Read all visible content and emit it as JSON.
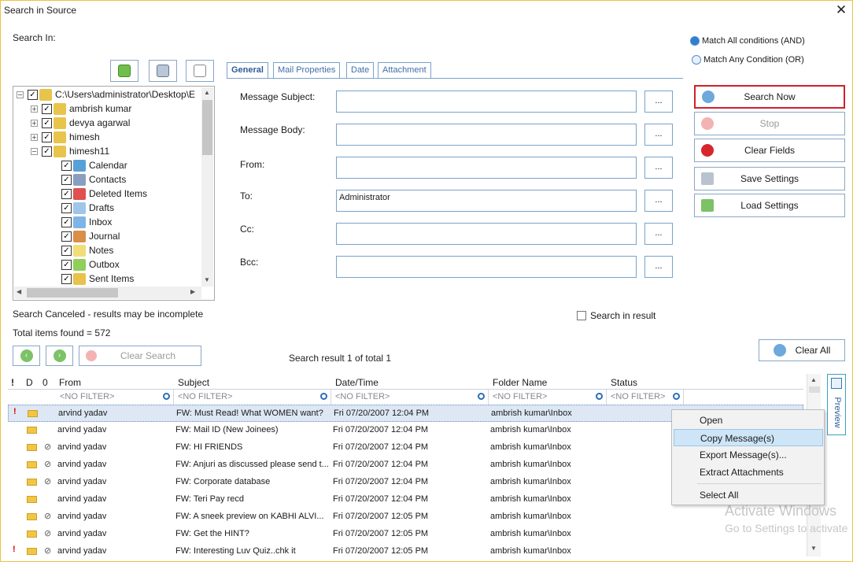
{
  "window": {
    "title": "Search in Source",
    "close": "✕"
  },
  "search_in_label": "Search In:",
  "tree": {
    "root": "C:\\Users\\administrator\\Desktop\\E",
    "items": [
      "ambrish kumar",
      "devya agarwal",
      "himesh",
      "himesh11"
    ],
    "folders": [
      "Calendar",
      "Contacts",
      "Deleted Items",
      "Drafts",
      "Inbox",
      "Journal",
      "Notes",
      "Outbox",
      "Sent Items"
    ]
  },
  "tabs": [
    "General",
    "Mail Properties",
    "Date",
    "Attachment"
  ],
  "fields": {
    "labels": [
      "Message Subject:",
      "Message Body:",
      "From:",
      "To:",
      "Cc:",
      "Bcc:"
    ],
    "to_value": "Administrator",
    "browse": "..."
  },
  "match": {
    "all": "Match All conditions (AND)",
    "any": "Match Any Condition (OR)"
  },
  "buttons": {
    "search_now": "Search Now",
    "stop": "Stop",
    "clear_fields": "Clear Fields",
    "save_settings": "Save Settings",
    "load_settings": "Load Settings",
    "clear_search": "Clear Search",
    "clear_all": "Clear All"
  },
  "status": {
    "canceled": "Search Canceled - results may be incomplete",
    "total": "Total items found = 572",
    "search_in_result": "Search in result",
    "result_info": "Search result 1 of total 1"
  },
  "grid": {
    "icon_headers": [
      "!",
      "D",
      "0"
    ],
    "columns": [
      "From",
      "Subject",
      "Date/Time",
      "Folder Name",
      "Status"
    ],
    "filter": "<NO FILTER>",
    "rows": [
      {
        "from": "arvind yadav",
        "subject": "FW: Must Read! What WOMEN want?",
        "date": "Fri 07/20/2007 12:04 PM",
        "folder": "ambrish kumar\\Inbox",
        "imp": true,
        "att": false
      },
      {
        "from": "arvind yadav",
        "subject": "FW: Mail ID (New Joinees)",
        "date": "Fri 07/20/2007 12:04 PM",
        "folder": "ambrish kumar\\Inbox",
        "imp": false,
        "att": false
      },
      {
        "from": "arvind yadav",
        "subject": "FW: HI FRIENDS",
        "date": "Fri 07/20/2007 12:04 PM",
        "folder": "ambrish kumar\\Inbox",
        "imp": false,
        "att": true
      },
      {
        "from": "arvind yadav",
        "subject": "FW: Anjuri as discussed please send t...",
        "date": "Fri 07/20/2007 12:04 PM",
        "folder": "ambrish kumar\\Inbox",
        "imp": false,
        "att": true
      },
      {
        "from": "arvind yadav",
        "subject": "FW: Corporate database",
        "date": "Fri 07/20/2007 12:04 PM",
        "folder": "ambrish kumar\\Inbox",
        "imp": false,
        "att": true
      },
      {
        "from": "arvind yadav",
        "subject": "FW: Teri Pay recd",
        "date": "Fri 07/20/2007 12:04 PM",
        "folder": "ambrish kumar\\Inbox",
        "imp": false,
        "att": false
      },
      {
        "from": "arvind yadav",
        "subject": "FW: A sneek preview on KABHI ALVI...",
        "date": "Fri 07/20/2007 12:05 PM",
        "folder": "ambrish kumar\\Inbox",
        "imp": false,
        "att": true
      },
      {
        "from": "arvind yadav",
        "subject": "FW: Get the HINT?",
        "date": "Fri 07/20/2007 12:05 PM",
        "folder": "ambrish kumar\\Inbox",
        "imp": false,
        "att": true
      },
      {
        "from": "arvind yadav",
        "subject": "FW: Interesting Luv Quiz..chk it",
        "date": "Fri 07/20/2007 12:05 PM",
        "folder": "ambrish kumar\\Inbox",
        "imp": true,
        "att": true
      }
    ]
  },
  "context_menu": [
    "Open",
    "Copy  Message(s)",
    "Export Message(s)...",
    "Extract Attachments",
    "Select All"
  ],
  "preview_tab": "Preview",
  "watermark": {
    "line1": "Activate Windows",
    "line2": "Go to Settings to activate"
  },
  "colors": {
    "accent": "#2c5d96",
    "highlight_border": "#d0202a",
    "selected_row": "#dde8f4"
  }
}
